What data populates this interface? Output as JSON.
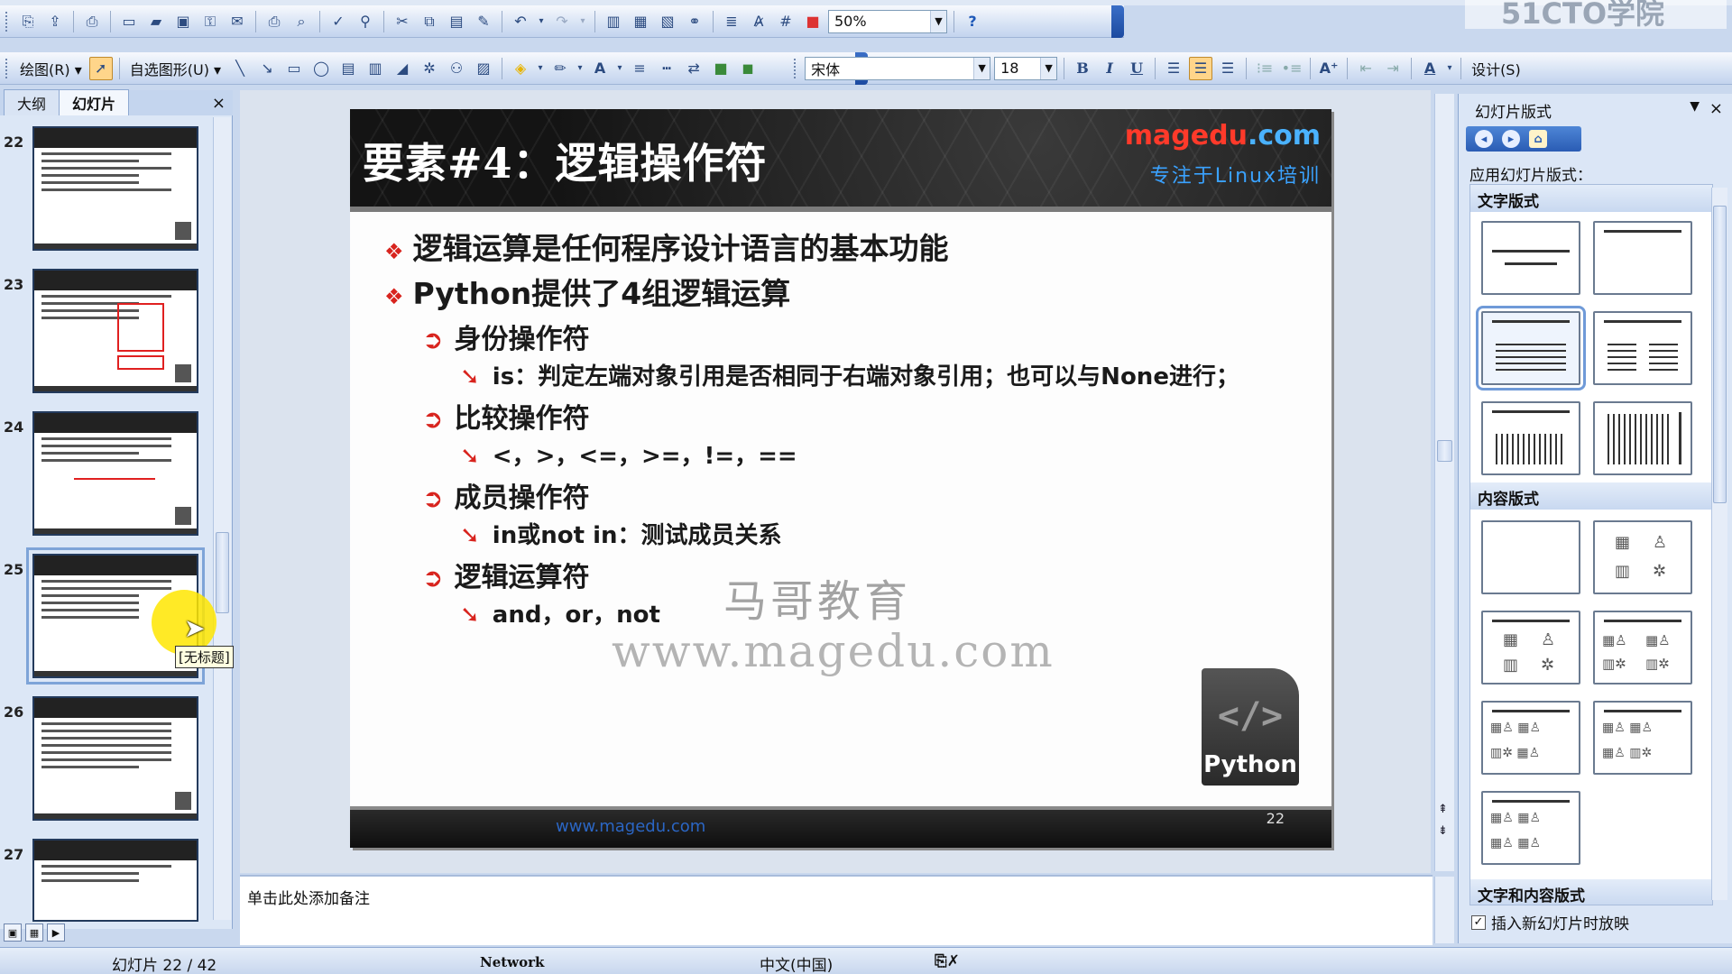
{
  "toolbar_standard": {
    "zoom": "50%",
    "help_icon": "help-icon"
  },
  "toolbar_drawing": {
    "draw_menu": "绘图(R) ▾",
    "autoshapes_menu": "自选图形(U) ▾",
    "font_name": "宋体",
    "font_size": "18",
    "bold": "B",
    "italic": "I",
    "underline": "U",
    "design_button": "设计(S)"
  },
  "left_pane": {
    "tabs": [
      "大纲",
      "幻灯片"
    ],
    "close": "×",
    "thumbnails": [
      {
        "num": "22"
      },
      {
        "num": "23"
      },
      {
        "num": "24"
      },
      {
        "num": "25"
      },
      {
        "num": "26"
      },
      {
        "num": "27"
      }
    ],
    "tooltip": "[无标题]"
  },
  "slide": {
    "title": "要素#4：逻辑操作符",
    "brand_name": "magedu",
    "brand_tld": ".com",
    "brand_tagline": "专注于Linux培训",
    "bullets_l1": [
      "逻辑运算是任何程序设计语言的基本功能",
      "Python提供了4组逻辑运算"
    ],
    "groups": [
      {
        "heading": "身份操作符",
        "detail": "is：判定左端对象引用是否相同于右端对象引用；也可以与None进行；"
      },
      {
        "heading": "比较操作符",
        "detail": "<，>，<=，>=，!=，=="
      },
      {
        "heading": "成员操作符",
        "detail": "in或not in：测试成员关系"
      },
      {
        "heading": "逻辑运算符",
        "detail": "and，or，not"
      }
    ],
    "watermark_cn": "马哥教育",
    "watermark_url": "www.magedu.com",
    "python_logo_code": "</>",
    "python_logo_text": "Python",
    "footer_url": "www.magedu.com",
    "page_number": "22"
  },
  "notes": {
    "placeholder": "单击此处添加备注"
  },
  "task_pane": {
    "title": "幻灯片版式",
    "apply_label": "应用幻灯片版式：",
    "sections": [
      "文字版式",
      "内容版式",
      "文字和内容版式"
    ],
    "checkbox_label": "插入新幻灯片时放映",
    "checkbox_checked": "✓"
  },
  "status_bar": {
    "slide_info": "幻灯片 22 / 42",
    "template": "Network",
    "language": "中文(中国)"
  },
  "logo_overlay": "51CTO学院"
}
